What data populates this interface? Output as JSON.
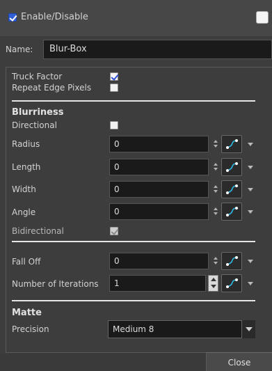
{
  "header": {
    "enable_label": "Enable/Disable",
    "enable_checked": true,
    "right_checkbox_checked": false
  },
  "name_row": {
    "label": "Name:",
    "value": "Blur-Box"
  },
  "options": {
    "truck_factor": {
      "label": "Truck Factor",
      "checked": true
    },
    "repeat_edge": {
      "label": "Repeat Edge Pixels",
      "checked": false
    }
  },
  "blurriness": {
    "title": "Blurriness",
    "directional": {
      "label": "Directional",
      "checked": false
    },
    "radius": {
      "label": "Radius",
      "value": "0"
    },
    "length": {
      "label": "Length",
      "value": "0"
    },
    "width": {
      "label": "Width",
      "value": "0"
    },
    "angle": {
      "label": "Angle",
      "value": "0"
    },
    "bidirectional": {
      "label": "Bidirectional",
      "checked": true,
      "enabled": false
    }
  },
  "falloff": {
    "label": "Fall Off",
    "value": "0"
  },
  "iterations": {
    "label": "Number of Iterations",
    "value": "1"
  },
  "matte": {
    "title": "Matte",
    "precision_label": "Precision",
    "precision_value": "Medium 8"
  },
  "footer": {
    "close_label": "Close"
  },
  "icons": {
    "function_curve": "function-curve-icon",
    "spin": "spin-arrows-icon",
    "dropdown": "chevron-down-icon"
  },
  "colors": {
    "background": "#3d3d3d",
    "field_bg": "#1a1a1a",
    "checkbox_check": "#2d4fd6",
    "curve_accent": "#2fb6e0"
  }
}
